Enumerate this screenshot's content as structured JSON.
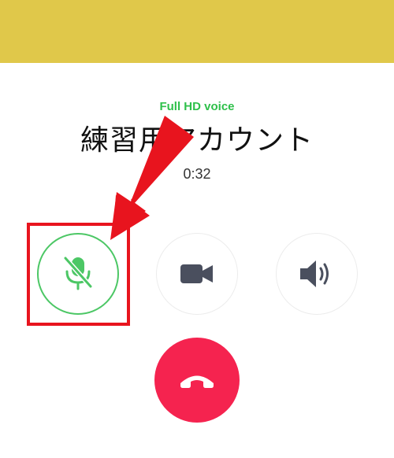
{
  "header": {
    "background_color": "#e0c84a"
  },
  "call": {
    "quality_label": "Full HD voice",
    "contact_name": "練習用アカウント",
    "duration": "0:32"
  },
  "controls": {
    "mute": {
      "icon": "mic-muted-icon",
      "active": true,
      "color": "#4cc765"
    },
    "video": {
      "icon": "video-camera-icon",
      "color": "#4a4f5e"
    },
    "speaker": {
      "icon": "speaker-icon",
      "color": "#4a4f5e"
    },
    "end_call": {
      "icon": "hang-up-icon",
      "color": "#f5234f"
    }
  },
  "annotation": {
    "color": "#e8141e",
    "target": "mute-button"
  }
}
